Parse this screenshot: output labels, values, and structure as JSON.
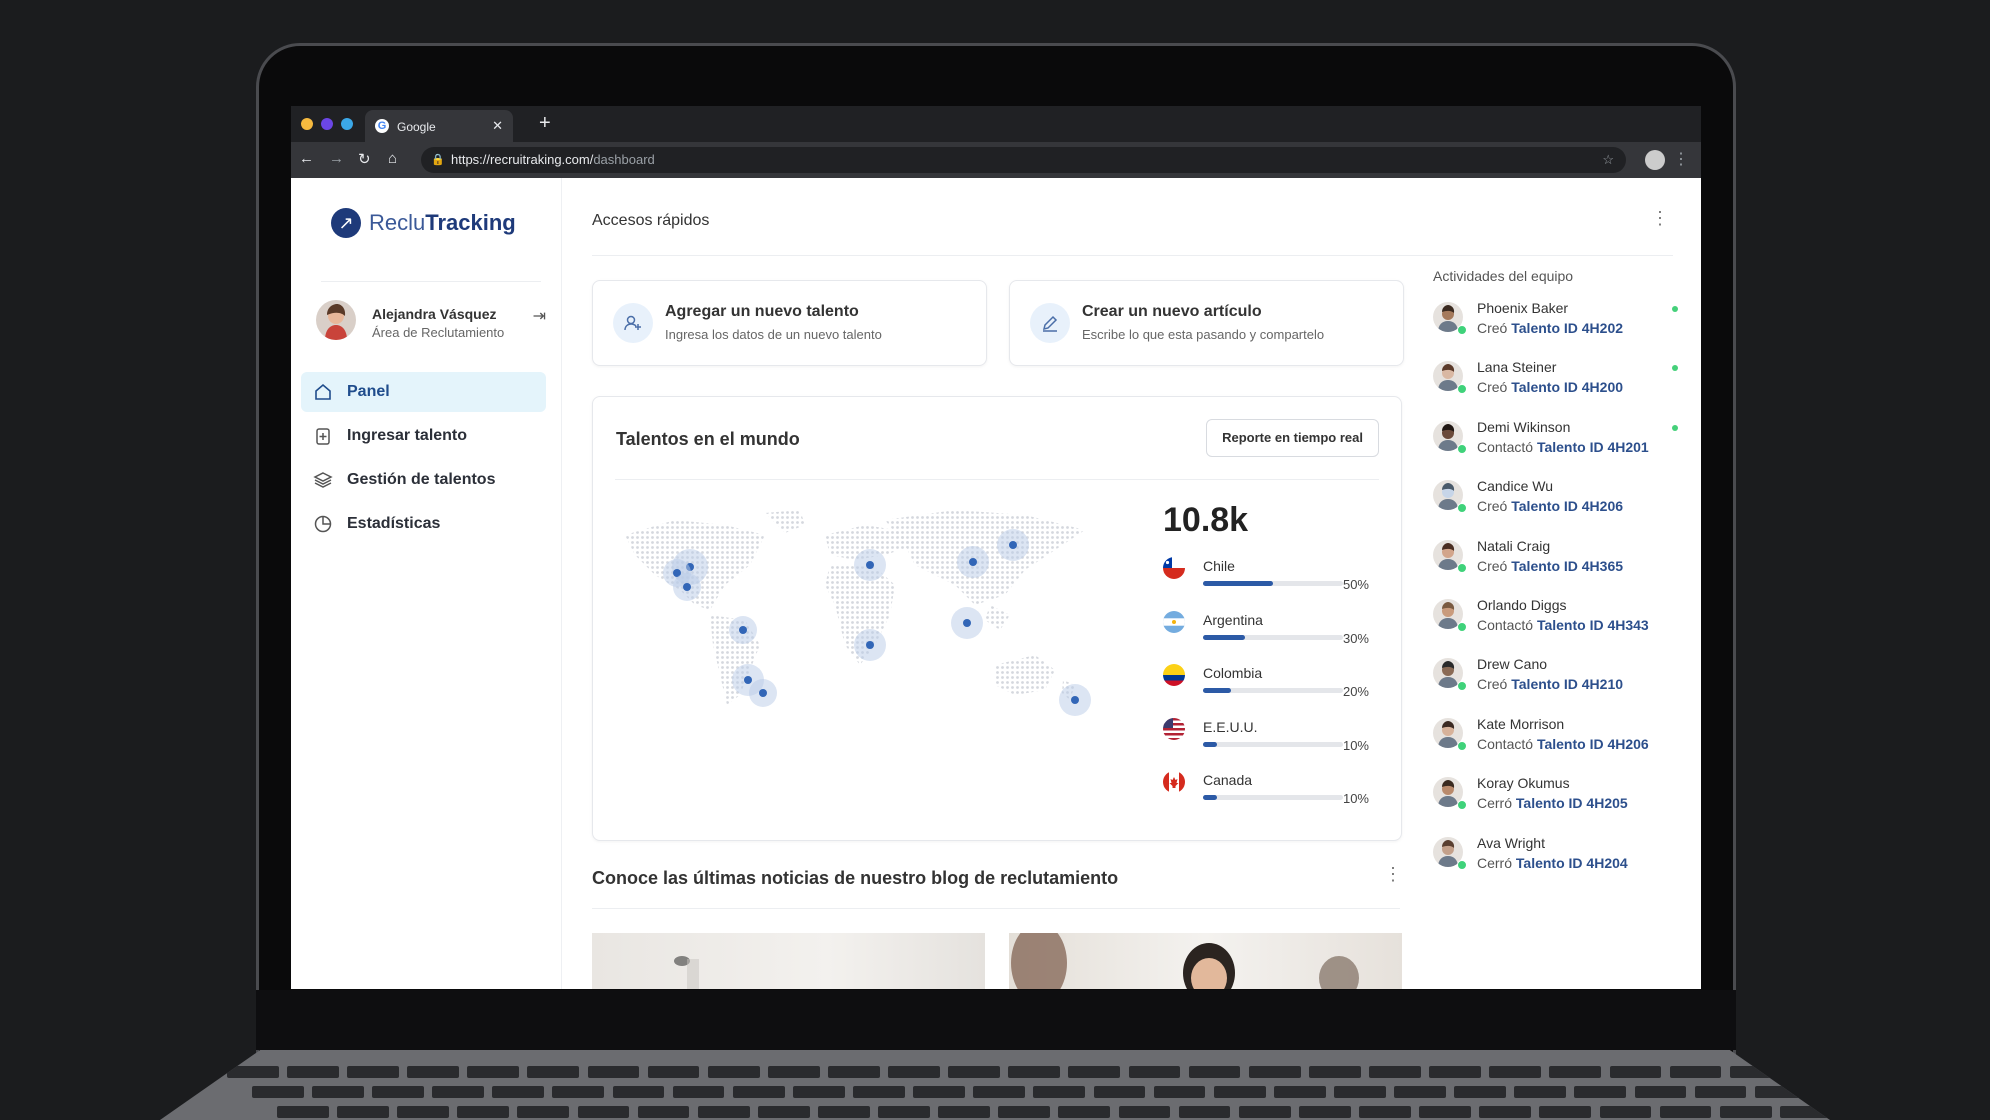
{
  "browser": {
    "tab_title": "Google",
    "url_host": "https://recruitraking.com/",
    "url_path": "dashboard"
  },
  "app": {
    "logo_part1": "Reclu",
    "logo_part2": "Tracking"
  },
  "user": {
    "name": "Alejandra Vásquez",
    "role": "Área de Reclutamiento"
  },
  "nav": [
    {
      "label": "Panel",
      "icon": "home-icon",
      "active": true
    },
    {
      "label": "Ingresar talento",
      "icon": "add-document-icon",
      "active": false
    },
    {
      "label": "Gestión de talentos",
      "icon": "layers-icon",
      "active": false
    },
    {
      "label": "Estadísticas",
      "icon": "pie-chart-icon",
      "active": false
    }
  ],
  "main": {
    "quick_access_title": "Accesos rápidos",
    "quick_actions": [
      {
        "title": "Agregar un nuevo talento",
        "subtitle": "Ingresa los datos de un nuevo talento",
        "icon": "user-plus-icon"
      },
      {
        "title": "Crear un nuevo artículo",
        "subtitle": "Escribe lo que esta pasando y compartelo",
        "icon": "pencil-icon"
      }
    ],
    "world": {
      "title": "Talentos en el mundo",
      "report_button": "Reporte en tiempo real",
      "total": "10.8k",
      "countries": [
        {
          "name": "Chile",
          "percent": "50%",
          "value": 0.5,
          "flag": "chile-flag"
        },
        {
          "name": "Argentina",
          "percent": "30%",
          "value": 0.3,
          "flag": "argentina-flag"
        },
        {
          "name": "Colombia",
          "percent": "20%",
          "value": 0.2,
          "flag": "colombia-flag"
        },
        {
          "name": "E.E.U.U.",
          "percent": "10%",
          "value": 0.1,
          "flag": "usa-flag"
        },
        {
          "name": "Canada",
          "percent": "10%",
          "value": 0.1,
          "flag": "canada-flag"
        }
      ]
    },
    "blog_title": "Conoce las últimas noticias de nuestro blog de reclutamiento"
  },
  "activity": {
    "title": "Actividades del equipo",
    "items": [
      {
        "name": "Phoenix Baker",
        "action": "Creó",
        "ref": "Talento ID 4H202",
        "unread": true
      },
      {
        "name": "Lana Steiner",
        "action": "Creó",
        "ref": "Talento ID 4H200",
        "unread": true
      },
      {
        "name": "Demi Wikinson",
        "action": "Contactó",
        "ref": "Talento ID 4H201",
        "unread": true
      },
      {
        "name": "Candice Wu",
        "action": "Creó",
        "ref": "Talento ID 4H206",
        "unread": false
      },
      {
        "name": "Natali Craig",
        "action": "Creó",
        "ref": "Talento ID 4H365",
        "unread": false
      },
      {
        "name": "Orlando Diggs",
        "action": "Contactó",
        "ref": "Talento ID 4H343",
        "unread": false
      },
      {
        "name": "Drew Cano",
        "action": "Creó",
        "ref": "Talento ID 4H210",
        "unread": false
      },
      {
        "name": "Kate Morrison",
        "action": "Contactó",
        "ref": "Talento ID 4H206",
        "unread": false
      },
      {
        "name": "Koray Okumus",
        "action": "Cerró",
        "ref": "Talento ID 4H205",
        "unread": false
      },
      {
        "name": "Ava Wright",
        "action": "Cerró",
        "ref": "Talento ID 4H204",
        "unread": false
      }
    ]
  }
}
